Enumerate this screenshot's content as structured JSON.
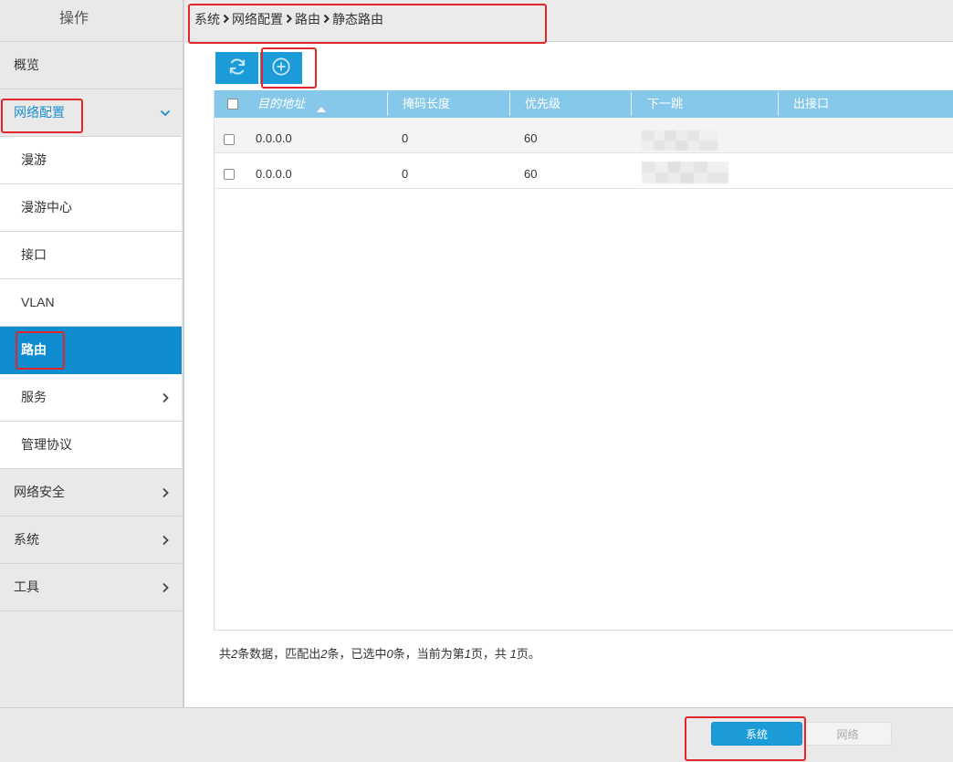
{
  "sidebar": {
    "title": "操作",
    "items": [
      {
        "label": "概览",
        "is_child": false
      },
      {
        "label": "网络配置",
        "is_child": false,
        "expanded": true,
        "icon": "chevron-down-icon"
      },
      {
        "label": "漫游",
        "is_child": true
      },
      {
        "label": "漫游中心",
        "is_child": true
      },
      {
        "label": "接口",
        "is_child": true
      },
      {
        "label": "VLAN",
        "is_child": true
      },
      {
        "label": "路由",
        "is_child": true,
        "active": true
      },
      {
        "label": "服务",
        "is_child": true,
        "icon": "chevron-right-icon"
      },
      {
        "label": "管理协议",
        "is_child": true
      },
      {
        "label": "网络安全",
        "is_child": false,
        "icon": "chevron-right-icon"
      },
      {
        "label": "系统",
        "is_child": false,
        "icon": "chevron-right-icon"
      },
      {
        "label": "工具",
        "is_child": false,
        "icon": "chevron-right-icon"
      }
    ]
  },
  "breadcrumb": {
    "items": [
      "系统",
      "网络配置",
      "路由",
      "静态路由"
    ],
    "separator_icon": "chevron-right-icon"
  },
  "toolbar": {
    "refresh_icon": "refresh-icon",
    "add_icon": "add-circle-icon"
  },
  "table": {
    "columns": [
      "目的地址",
      "掩码长度",
      "优先级",
      "下一跳",
      "出接口"
    ],
    "sorted_column": 0,
    "sort_icon": "triangle-up-icon",
    "select_all_checked": false,
    "rows": [
      {
        "checked": false,
        "destination": "0.0.0.0",
        "mask_length": "0",
        "priority": "60",
        "next_hop_redacted": true,
        "out_interface": ""
      },
      {
        "checked": false,
        "destination": "0.0.0.0",
        "mask_length": "0",
        "priority": "60",
        "next_hop_redacted": true,
        "out_interface": ""
      }
    ]
  },
  "summary": {
    "prefix": "共",
    "total": "2",
    "after_total": "条数据，匹配出",
    "matched": "2",
    "after_matched": "条，已选中",
    "selected": "0",
    "after_selected": "条，当前为第",
    "current_page": "1",
    "after_page": "页，共 ",
    "total_pages": "1",
    "suffix": "页。"
  },
  "bottom_tabs": [
    {
      "label": "系统",
      "active": true
    },
    {
      "label": "网络",
      "active": false
    }
  ],
  "colors": {
    "accent": "#1b9bd7",
    "active_nav": "#0d8dcf",
    "expanded_nav_text": "#1a8fd0",
    "table_header": "#86c8e9",
    "annotation": "#e3262b",
    "sidebar_bg": "#e9e9e9"
  }
}
